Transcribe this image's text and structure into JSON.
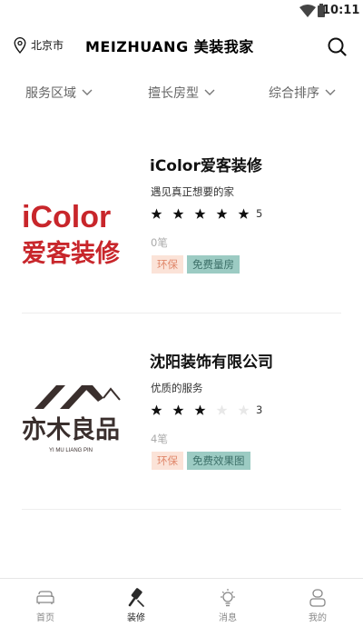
{
  "status": {
    "time": "10:11"
  },
  "header": {
    "location": "北京市",
    "title": "MEIZHUANG 美装我家"
  },
  "filters": [
    {
      "label": "服务区域"
    },
    {
      "label": "擅长房型"
    },
    {
      "label": "综合排序"
    }
  ],
  "listings": [
    {
      "name": "iColor爱客装修",
      "slogan": "遇见真正想要的家",
      "rating": 5,
      "rating_text": "5",
      "orders": "0笔",
      "tags": [
        "环保",
        "免费量房"
      ],
      "logo": {
        "line1": "iColor",
        "line2": "爱客装修"
      }
    },
    {
      "name": "沈阳装饰有限公司",
      "slogan": "优质的服务",
      "rating": 3,
      "rating_text": "3",
      "orders": "4笔",
      "tags": [
        "环保",
        "免费效果图"
      ],
      "logo": {
        "line1": "亦木良品",
        "line2": "YI MU LIANG PIN"
      }
    }
  ],
  "bottom_nav": [
    {
      "label": "首页",
      "icon": "sofa-icon",
      "active": false
    },
    {
      "label": "装修",
      "icon": "brush-icon",
      "active": true
    },
    {
      "label": "消息",
      "icon": "lightbulb-icon",
      "active": false
    },
    {
      "label": "我的",
      "icon": "user-icon",
      "active": false
    }
  ],
  "colors": {
    "tag_primary_bg": "#fbe3d8",
    "tag_primary_text": "#e0876a",
    "tag_secondary_bg": "#9ccbc3",
    "tag_secondary_text": "#3c6f68",
    "star_filled": "#111111",
    "star_empty": "#e8e8e8",
    "icolor_logo_red": "#c8262b"
  }
}
